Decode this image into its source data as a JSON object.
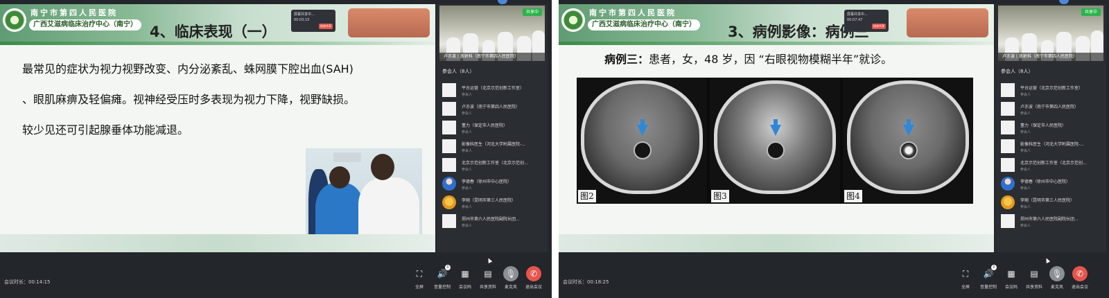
{
  "left": {
    "slide": {
      "org_name": "南宁市第四人民医院",
      "org_center": "广西艾滋病临床治疗中心（南宁）",
      "title": "4、临床表现（一）",
      "paragraph": "最常见的症状为视力视野改变、内分泌紊乱、蛛网膜下腔出血(SAH) 、眼肌麻痹及轻偏瘫。视神经受压时多表现为视力下降，视野缺损。较少见还可引起腺垂体功能减退。",
      "popup_title": "屏幕共享中...",
      "popup_time": "00:03:15",
      "popup_button": "结束共享"
    },
    "video": {
      "share_badge": "共享中",
      "caption": "卢亦波 | 放射科（南宁市第四人民医院）"
    },
    "participants_header": "参会人（8人）",
    "participants": [
      {
        "name": "平台运营（北京示范创新工作室）",
        "role": "参会人",
        "avatar": "blank"
      },
      {
        "name": "卢亦波（南宁市第四人民医院）",
        "role": "参会人",
        "avatar": "blank"
      },
      {
        "name": "董力（保定市人民医院）",
        "role": "参会人",
        "avatar": "blank"
      },
      {
        "name": "影像科医生（河北大学附属医院-...",
        "role": "参会人",
        "avatar": "blank"
      },
      {
        "name": "北京示范创新工作室（北京示范创...",
        "role": "参会人",
        "avatar": "blank"
      },
      {
        "name": "李德春（徐州市中心医院）",
        "role": "参会人",
        "avatar": "blue"
      },
      {
        "name": "李翔（昆明市第三人民医院）",
        "role": "参会人",
        "avatar": "gold"
      },
      {
        "name": "郑州市第六人民医院副院长团...",
        "role": "参会人",
        "avatar": "blank"
      }
    ],
    "duration": "会议时长：00:14:15",
    "controls": [
      {
        "label": "全屏",
        "icon": "fullscreen-icon",
        "glyph": "⛶"
      },
      {
        "label": "音量控制",
        "icon": "volume-icon",
        "glyph": "🔊",
        "badge": "0"
      },
      {
        "label": "会议码",
        "icon": "qr-code-icon",
        "glyph": "▦"
      },
      {
        "label": "共享资料",
        "icon": "document-icon",
        "glyph": "▤"
      },
      {
        "label": "麦克风",
        "icon": "microphone-icon",
        "glyph": "🎙"
      },
      {
        "label": "退出会议",
        "icon": "hang-up-icon",
        "glyph": "✆"
      }
    ]
  },
  "right": {
    "slide": {
      "org_name": "南宁市第四人民医院",
      "org_center": "广西艾滋病临床治疗中心（南宁）",
      "title": "3、病例影像：病例三",
      "case_bold": "病例三：",
      "case_text": "患者，女，48 岁，因 “右眼视物模糊半年”就诊。",
      "figures": [
        "图2",
        "图3",
        "图4"
      ],
      "popup_title": "屏幕共享中...",
      "popup_time": "00:07:47",
      "popup_button": "结束共享"
    },
    "video": {
      "share_badge": "共享中",
      "caption": "卢亦波 | 放射科（南宁市第四人民医院）"
    },
    "participants_header": "参会人（8人）",
    "participants": [
      {
        "name": "平台运营（北京示范创新工作室）",
        "role": "参会人",
        "avatar": "blank"
      },
      {
        "name": "卢亦波（南宁市第四人民医院）",
        "role": "参会人",
        "avatar": "blank"
      },
      {
        "name": "董力（保定市人民医院）",
        "role": "参会人",
        "avatar": "blank"
      },
      {
        "name": "影像科医生（河北大学附属医院-...",
        "role": "参会人",
        "avatar": "blank"
      },
      {
        "name": "北京示范创新工作室（北京示范创...",
        "role": "参会人",
        "avatar": "blank"
      },
      {
        "name": "李德春（徐州市中心医院）",
        "role": "参会人",
        "avatar": "blue"
      },
      {
        "name": "李翔（昆明市第三人民医院）",
        "role": "参会人",
        "avatar": "gold"
      },
      {
        "name": "郑州市第六人民医院副院长团...",
        "role": "参会人",
        "avatar": "blank"
      }
    ],
    "duration": "会议时长：00:18:25",
    "controls": [
      {
        "label": "全屏",
        "icon": "fullscreen-icon",
        "glyph": "⛶"
      },
      {
        "label": "音量控制",
        "icon": "volume-icon",
        "glyph": "🔊",
        "badge": "0"
      },
      {
        "label": "会议码",
        "icon": "qr-code-icon",
        "glyph": "▦"
      },
      {
        "label": "共享资料",
        "icon": "document-icon",
        "glyph": "▤"
      },
      {
        "label": "麦克风",
        "icon": "microphone-icon",
        "glyph": "🎙"
      },
      {
        "label": "退出会议",
        "icon": "hang-up-icon",
        "glyph": "✆"
      }
    ]
  }
}
